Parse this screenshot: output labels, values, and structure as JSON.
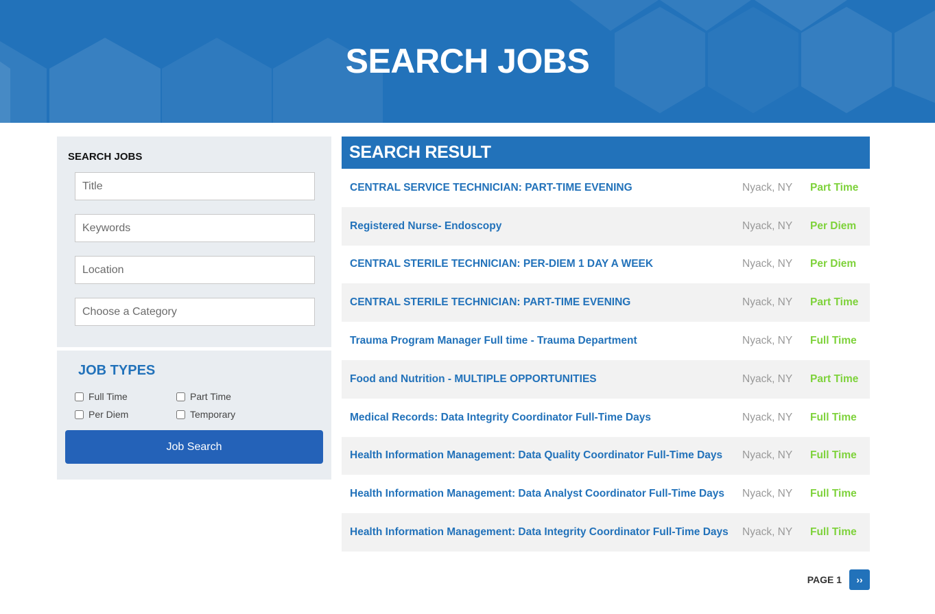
{
  "hero": {
    "title": "SEARCH JOBS"
  },
  "sidebar": {
    "search_title": "SEARCH JOBS",
    "fields": {
      "title_placeholder": "Title",
      "keywords_placeholder": "Keywords",
      "location_placeholder": "Location",
      "category_placeholder": "Choose a Category"
    },
    "job_types_title": "JOB TYPES",
    "job_types": [
      "Full Time",
      "Part Time",
      "Per Diem",
      "Temporary"
    ],
    "search_button": "Job Search"
  },
  "results": {
    "header": "SEARCH RESULT",
    "jobs": [
      {
        "title": "CENTRAL SERVICE TECHNICIAN: PART-TIME EVENING",
        "location": "Nyack, NY",
        "type": "Part Time"
      },
      {
        "title": "Registered Nurse- Endoscopy",
        "location": "Nyack, NY",
        "type": "Per Diem"
      },
      {
        "title": "CENTRAL STERILE TECHNICIAN: PER-DIEM 1 DAY A WEEK",
        "location": "Nyack, NY",
        "type": "Per Diem"
      },
      {
        "title": "CENTRAL STERILE TECHNICIAN: PART-TIME EVENING",
        "location": "Nyack, NY",
        "type": "Part Time"
      },
      {
        "title": "Trauma Program Manager Full time - Trauma Department",
        "location": "Nyack, NY",
        "type": "Full Time"
      },
      {
        "title": "Food and Nutrition - MULTIPLE OPPORTUNITIES",
        "location": "Nyack, NY",
        "type": "Part Time"
      },
      {
        "title": "Medical Records: Data Integrity Coordinator Full-Time Days",
        "location": "Nyack, NY",
        "type": "Full Time"
      },
      {
        "title": "Health Information Management: Data Quality Coordinator Full-Time Days",
        "location": "Nyack, NY",
        "type": "Full Time"
      },
      {
        "title": "Health Information Management: Data Analyst Coordinator Full-Time Days",
        "location": "Nyack, NY",
        "type": "Full Time"
      },
      {
        "title": "Health Information Management: Data Integrity Coordinator Full-Time Days",
        "location": "Nyack, NY",
        "type": "Full Time"
      }
    ]
  },
  "pagination": {
    "label": "PAGE 1",
    "next_icon": "double-chevron-right-icon",
    "next_glyph": "››"
  },
  "colors": {
    "brand_blue": "#2272ba",
    "button_blue": "#2462b8",
    "type_green": "#7ed23b",
    "location_gray": "#999999",
    "panel_bg": "#e9edf1"
  }
}
